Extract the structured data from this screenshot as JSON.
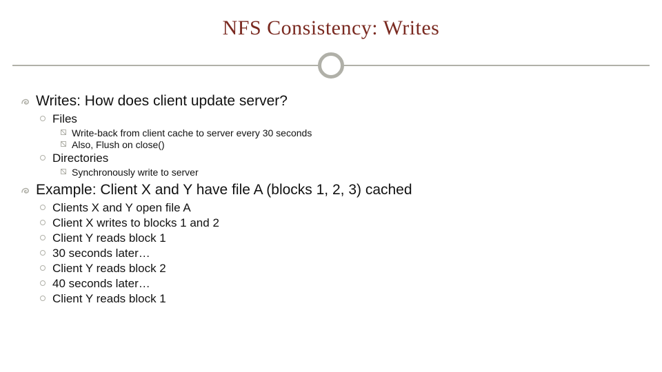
{
  "title": "NFS Consistency: Writes",
  "section1": {
    "heading": "Writes: How does client update server?",
    "files": {
      "label": "Files",
      "items": [
        "Write-back from client cache to server every 30 seconds",
        "Also, Flush on close()"
      ]
    },
    "dirs": {
      "label": "Directories",
      "items": [
        "Synchronously write to server"
      ]
    }
  },
  "section2": {
    "heading": "Example: Client X and Y have file A (blocks 1, 2, 3) cached",
    "steps": [
      "Clients X and Y open file A",
      "Client X writes to blocks 1 and 2",
      "Client Y reads block 1",
      "30 seconds later…",
      "Client Y reads block 2",
      "40 seconds later…",
      "Client Y reads block 1"
    ]
  }
}
